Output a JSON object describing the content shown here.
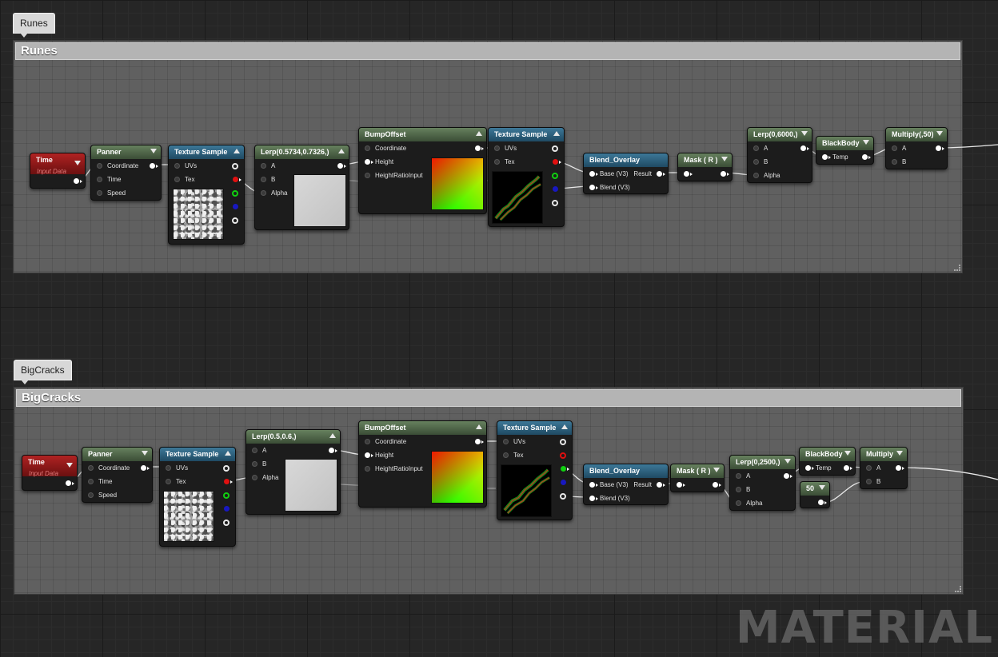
{
  "groups": [
    {
      "tab_label": "Runes",
      "header": "Runes",
      "nodes": {
        "time": {
          "title": "Time",
          "subtitle": "Input Data"
        },
        "panner": {
          "title": "Panner",
          "inputs": [
            "Coordinate",
            "Time",
            "Speed"
          ]
        },
        "texture_sample_1": {
          "title": "Texture Sample",
          "inputs": [
            "UVs",
            "Tex"
          ]
        },
        "lerp_1": {
          "title": "Lerp(0.5734,0.7326,)",
          "inputs": [
            "A",
            "B",
            "Alpha"
          ]
        },
        "bump_offset": {
          "title": "BumpOffset",
          "inputs": [
            "Coordinate",
            "Height",
            "HeightRatioInput"
          ]
        },
        "texture_sample_2": {
          "title": "Texture Sample",
          "inputs": [
            "UVs",
            "Tex"
          ]
        },
        "blend_overlay": {
          "title": "Blend_Overlay",
          "inputs": [
            "Base (V3)",
            "Blend (V3)"
          ],
          "output": "Result"
        },
        "mask": {
          "title": "Mask ( R )"
        },
        "lerp_2": {
          "title": "Lerp(0,6000,)",
          "inputs": [
            "A",
            "B",
            "Alpha"
          ]
        },
        "blackbody": {
          "title": "BlackBody",
          "inputs": [
            "Temp"
          ]
        },
        "multiply": {
          "title": "Multiply(,50)",
          "inputs": [
            "A",
            "B"
          ]
        }
      }
    },
    {
      "tab_label": "BigCracks",
      "header": "BigCracks",
      "nodes": {
        "time": {
          "title": "Time",
          "subtitle": "Input Data"
        },
        "panner": {
          "title": "Panner",
          "inputs": [
            "Coordinate",
            "Time",
            "Speed"
          ]
        },
        "texture_sample_1": {
          "title": "Texture Sample",
          "inputs": [
            "UVs",
            "Tex"
          ]
        },
        "lerp_1": {
          "title": "Lerp(0.5,0.6,)",
          "inputs": [
            "A",
            "B",
            "Alpha"
          ]
        },
        "bump_offset": {
          "title": "BumpOffset",
          "inputs": [
            "Coordinate",
            "Height",
            "HeightRatioInput"
          ]
        },
        "texture_sample_2": {
          "title": "Texture Sample",
          "inputs": [
            "UVs",
            "Tex"
          ]
        },
        "blend_overlay": {
          "title": "Blend_Overlay",
          "inputs": [
            "Base (V3)",
            "Blend (V3)"
          ],
          "output": "Result"
        },
        "mask": {
          "title": "Mask ( R )"
        },
        "lerp_2": {
          "title": "Lerp(0,2500,)",
          "inputs": [
            "A",
            "B",
            "Alpha"
          ]
        },
        "blackbody": {
          "title": "BlackBody",
          "inputs": [
            "Temp"
          ]
        },
        "constant": {
          "title": "50"
        },
        "multiply": {
          "title": "Multiply",
          "inputs": [
            "A",
            "B"
          ]
        }
      }
    }
  ],
  "watermark": "MATERIAL"
}
